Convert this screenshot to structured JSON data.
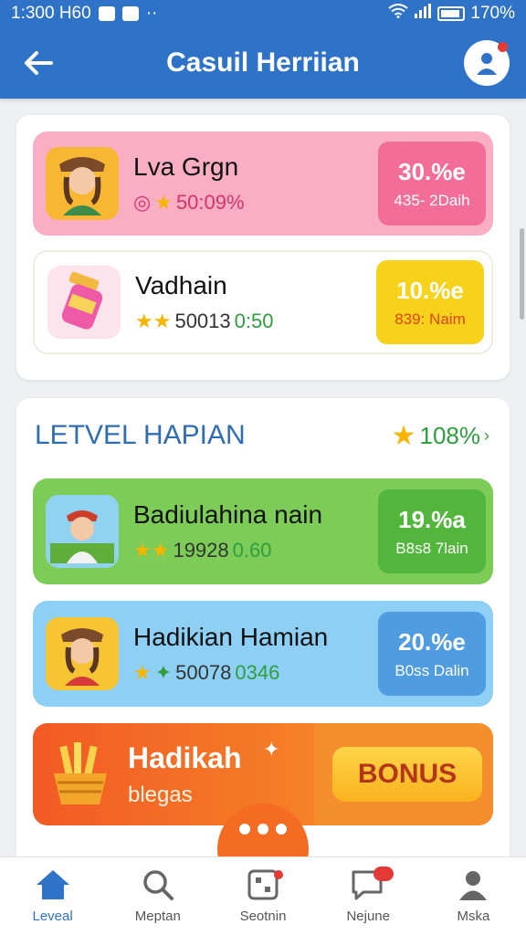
{
  "status_bar": {
    "time": "1:300 H60",
    "battery": "170%"
  },
  "header": {
    "title": "Casuil Herriian"
  },
  "top_cards": [
    {
      "title": "Lva Grgn",
      "meta": "50:09%",
      "badge_pct": "30.%e",
      "badge_sub": "435- 2Daih",
      "bg": "#f9aec4",
      "badge_bg": "#f26e98"
    },
    {
      "title": "Vadhain",
      "meta": "50013",
      "meta_green": "0:50",
      "badge_pct": "10.%e",
      "badge_sub": "839: Naim",
      "bg": "#ffffff",
      "badge_bg": "#f6d21a"
    }
  ],
  "section": {
    "title": "LETVEL HAPIAN",
    "score": "108%"
  },
  "section_cards": [
    {
      "title": "Badiulahina nain",
      "meta": "19928",
      "meta_green": "0.60",
      "badge_pct": "19.%a",
      "badge_sub": "B8s8 7lain",
      "bg": "#7ccc57",
      "badge_bg": "#53b63c"
    },
    {
      "title": "Hadikian Hamian",
      "meta": "50078",
      "meta_green": "0346",
      "badge_pct": "20.%e",
      "badge_sub": "B0ss Dalin",
      "bg": "#8ed0f5",
      "badge_bg": "#4f9de0"
    }
  ],
  "bonus": {
    "title": "Hadikah",
    "subtitle": "blegas",
    "button": "BONUS"
  },
  "nav": [
    {
      "label": "Leveal"
    },
    {
      "label": "Meptan"
    },
    {
      "label": "Seotnin"
    },
    {
      "label": "Nejune"
    },
    {
      "label": "Mska"
    }
  ]
}
